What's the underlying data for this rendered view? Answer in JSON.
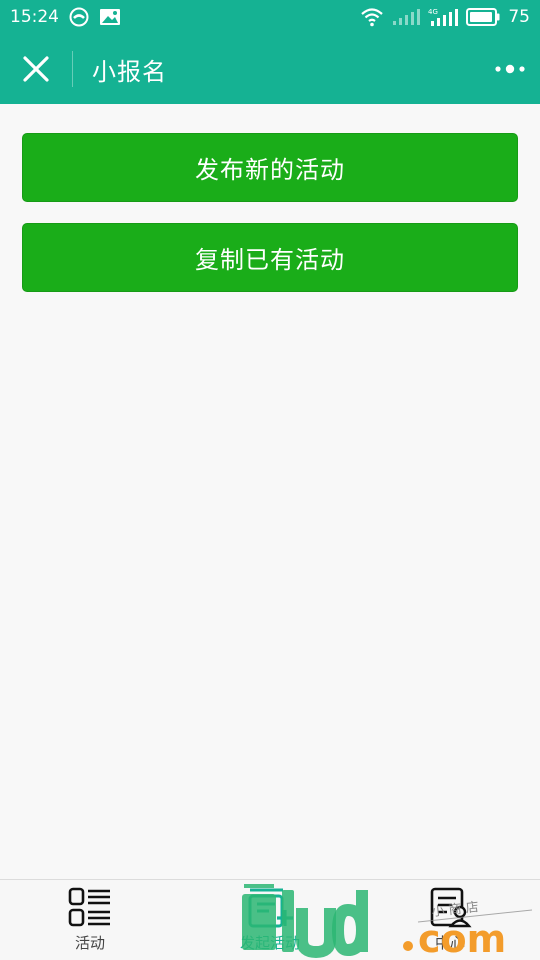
{
  "status_bar": {
    "time": "15:24",
    "battery": "75",
    "network": "4G",
    "icons": [
      "app-notification-icon",
      "image-notification-icon",
      "wifi-icon",
      "signal-icon",
      "signal-4g-icon",
      "battery-icon"
    ]
  },
  "app_bar": {
    "title": "小报名",
    "close_icon": "close-icon",
    "more_icon": "more-icon"
  },
  "main": {
    "buttons": [
      {
        "label": "发布新的活动"
      },
      {
        "label": "复制已有活动"
      }
    ],
    "accent": "#1aad19",
    "header_color": "#15b293"
  },
  "tab_bar": {
    "tabs": [
      {
        "label": "活动",
        "icon": "activity-list-icon"
      },
      {
        "label": "发起活动",
        "icon": "create-activity-icon",
        "active": true
      },
      {
        "label": "中心",
        "icon": "user-center-icon"
      }
    ]
  },
  "watermark": {
    "text": "lud.com",
    "sub": "小 商 店"
  }
}
